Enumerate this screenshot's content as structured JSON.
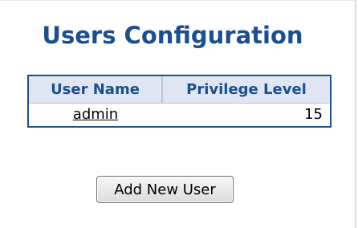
{
  "page": {
    "title": "Users Configuration"
  },
  "users_table": {
    "columns": [
      "User Name",
      "Privilege Level"
    ],
    "rows": [
      {
        "user_name": "admin",
        "privilege_level": "15"
      }
    ]
  },
  "actions": {
    "add_user_label": "Add New User"
  },
  "colors": {
    "title": "#1e4e8c",
    "header_bg": "#dfe6f2",
    "border": "#1e4e8c"
  }
}
